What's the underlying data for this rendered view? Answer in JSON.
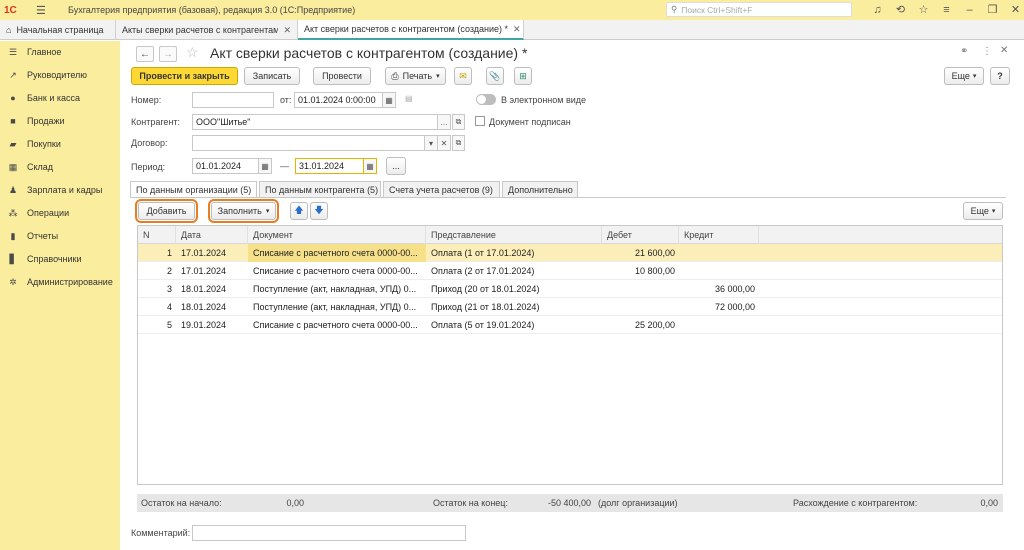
{
  "app": {
    "title": "Бухгалтерия предприятия (базовая), редакция 3.0  (1С:Предприятие)",
    "search_placeholder": "Поиск Ctrl+Shift+F"
  },
  "tabs": [
    {
      "label": "Начальная страница"
    },
    {
      "label": "Акты сверки расчетов с контрагентами"
    },
    {
      "label": "Акт сверки расчетов с контрагентом (создание) *"
    }
  ],
  "sidebar": {
    "items": [
      {
        "label": "Главное",
        "icon": "menu-icon"
      },
      {
        "label": "Руководителю",
        "icon": "trend-icon"
      },
      {
        "label": "Банк и касса",
        "icon": "bank-icon"
      },
      {
        "label": "Продажи",
        "icon": "bag-icon"
      },
      {
        "label": "Покупки",
        "icon": "cart-icon"
      },
      {
        "label": "Склад",
        "icon": "warehouse-icon"
      },
      {
        "label": "Зарплата и кадры",
        "icon": "person-icon"
      },
      {
        "label": "Операции",
        "icon": "operations-icon"
      },
      {
        "label": "Отчеты",
        "icon": "chart-icon"
      },
      {
        "label": "Справочники",
        "icon": "book-icon"
      },
      {
        "label": "Администрирование",
        "icon": "gear-icon"
      }
    ]
  },
  "document": {
    "title": "Акт сверки расчетов с контрагентом (создание) *",
    "toolbar": {
      "post_close": "Провести и закрыть",
      "save": "Записать",
      "post": "Провести",
      "print": "Печать",
      "more": "Еще",
      "help": "?"
    },
    "fields": {
      "number_label": "Номер:",
      "number_value": "",
      "from_label": "от:",
      "from_value": "01.01.2024  0:00:00",
      "electronic_label": "В электронном виде",
      "counterparty_label": "Контрагент:",
      "counterparty_value": "ООО\"Шитье\"",
      "signed_label": "Документ подписан",
      "contract_label": "Договор:",
      "contract_value": "",
      "period_label": "Период:",
      "period_from": "01.01.2024",
      "period_dash": "—",
      "period_to": "31.01.2024",
      "period_more": "...",
      "comment_label": "Комментарий:",
      "comment_value": ""
    },
    "form_tabs": [
      {
        "label": "По данным организации (5)"
      },
      {
        "label": "По данным контрагента (5)"
      },
      {
        "label": "Счета учета расчетов (9)"
      },
      {
        "label": "Дополнительно"
      }
    ],
    "table_toolbar": {
      "add": "Добавить",
      "fill": "Заполнить",
      "more": "Еще"
    },
    "table": {
      "columns": [
        "N",
        "Дата",
        "Документ",
        "Представление",
        "Дебет",
        "Кредит"
      ],
      "rows": [
        {
          "n": "1",
          "date": "17.01.2024",
          "doc": "Списание с расчетного счета 0000-00...",
          "repr": "Оплата (1 от 17.01.2024)",
          "debit": "21 600,00",
          "credit": ""
        },
        {
          "n": "2",
          "date": "17.01.2024",
          "doc": "Списание с расчетного счета 0000-00...",
          "repr": "Оплата (2 от 17.01.2024)",
          "debit": "10 800,00",
          "credit": ""
        },
        {
          "n": "3",
          "date": "18.01.2024",
          "doc": "Поступление (акт, накладная, УПД) 0...",
          "repr": "Приход (20 от 18.01.2024)",
          "debit": "",
          "credit": "36 000,00"
        },
        {
          "n": "4",
          "date": "18.01.2024",
          "doc": "Поступление (акт, накладная, УПД) 0...",
          "repr": "Приход (21 от 18.01.2024)",
          "debit": "",
          "credit": "72 000,00"
        },
        {
          "n": "5",
          "date": "19.01.2024",
          "doc": "Списание с расчетного счета 0000-00...",
          "repr": "Оплата (5 от 19.01.2024)",
          "debit": "25 200,00",
          "credit": ""
        }
      ]
    },
    "footer": {
      "start_label": "Остаток на начало:",
      "start_value": "0,00",
      "end_label": "Остаток на конец:",
      "end_value": "-50 400,00",
      "end_note": "(долг организации)",
      "diff_label": "Расхождение с контрагентом:",
      "diff_value": "0,00"
    }
  },
  "colors": {
    "panel": "#fbed9e",
    "primary_button": "#fdd835",
    "highlight_outline": "#e67e22",
    "selected_row": "#fbeeb9",
    "active_tab_underline": "#3fa7a0"
  }
}
